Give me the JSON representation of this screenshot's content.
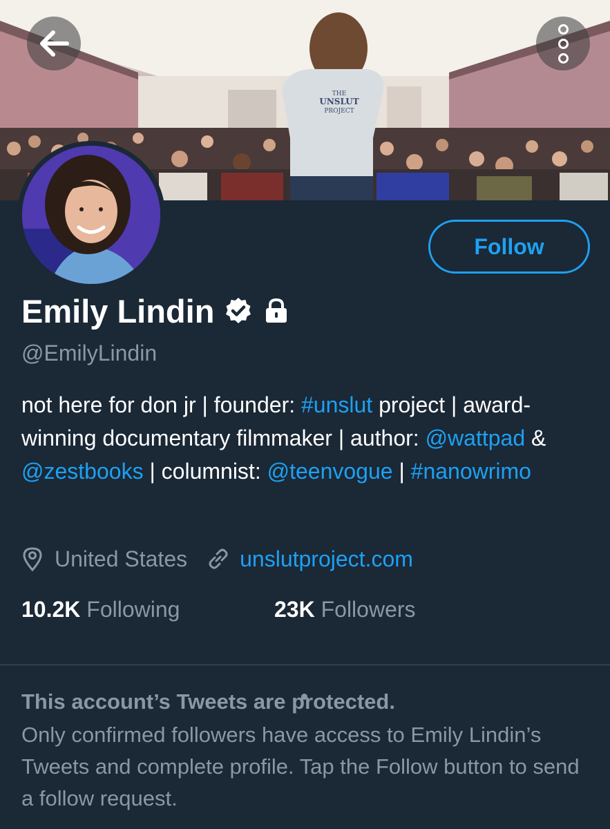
{
  "profile": {
    "name": "Emily Lindin",
    "handle": "@EmilyLindin",
    "follow_label": "Follow",
    "bio": {
      "t1": "not here for don jr | founder: ",
      "l1": "#unslut",
      "t2": " project | award-winning documentary filmmaker | author: ",
      "l2": "@wattpad",
      "t3": " & ",
      "l3": "@zestbooks",
      "t4": " | columnist: ",
      "l4": "@teenvogue",
      "t5": " | ",
      "l5": "#nanowrimo"
    },
    "location": "United States",
    "website": "unslutproject.com",
    "following_count": "10.2K",
    "following_label": "Following",
    "followers_count": "23K",
    "followers_label": "Followers"
  },
  "banner": {
    "shirt_line1": "THE",
    "shirt_line2": "UNSLUT",
    "shirt_line3": "PROJECT"
  },
  "protected": {
    "title": "This account’s Tweets are protected.",
    "body": "Only confirmed followers have access to Emily Lindin’s Tweets and complete profile. Tap the Follow button to send a follow request."
  },
  "icons": {
    "back": "arrow-left-icon",
    "more": "more-vertical-icon",
    "verified": "verified-badge-icon",
    "lock": "lock-icon",
    "location": "location-pin-icon",
    "link": "link-icon"
  },
  "colors": {
    "background": "#1b2836",
    "accent": "#1da1f2",
    "muted": "#8899a6",
    "divider": "#3d5466"
  }
}
